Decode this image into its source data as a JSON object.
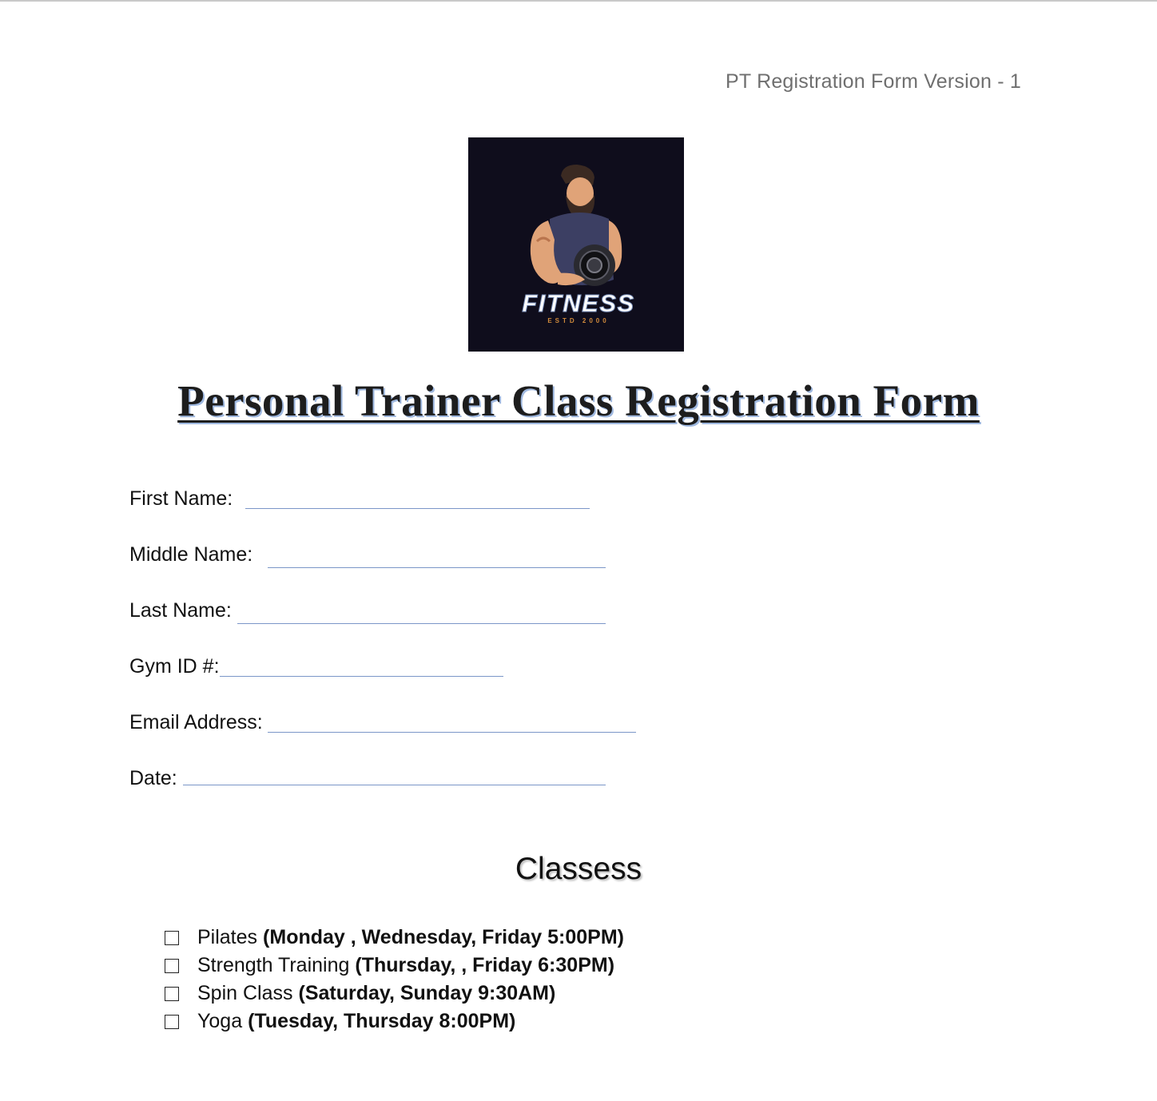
{
  "header": {
    "version_text": "PT Registration Form Version - 1"
  },
  "logo": {
    "brand": "FITNESS",
    "tagline": "ESTD 2000"
  },
  "title": "Personal Trainer Class Registration Form",
  "fields": [
    {
      "label": "First Name:"
    },
    {
      "label": "Middle Name:"
    },
    {
      "label": "Last Name:"
    },
    {
      "label": "Gym ID #:"
    },
    {
      "label": "Email Address:"
    },
    {
      "label": "Date:"
    }
  ],
  "classes": {
    "heading": "Classess",
    "items": [
      {
        "name": "Pilates ",
        "schedule": "(Monday , Wednesday, Friday 5:00PM)"
      },
      {
        "name": "Strength Training",
        "schedule": "(Thursday, , Friday 6:30PM)"
      },
      {
        "name": "Spin Class",
        "schedule": "(Saturday, Sunday 9:30AM)"
      },
      {
        "name": "Yoga",
        "schedule": "(Tuesday, Thursday 8:00PM)"
      }
    ]
  },
  "colors": {
    "line": "#7b96c8",
    "logo_bg": "#0f0d1c",
    "title_shadow": "#9fb8df",
    "version_text": "#6f6f6f"
  }
}
